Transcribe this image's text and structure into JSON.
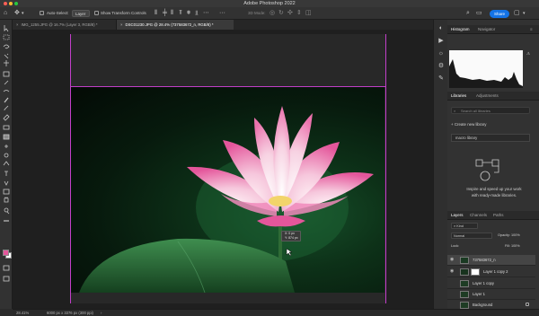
{
  "app": {
    "title": "Adobe Photoshop 2022"
  },
  "options_bar": {
    "auto_select_label": "Auto-Select:",
    "auto_select_value": "Layer",
    "show_transform_label": "Show Transform Controls",
    "mode_3d_label": "3D Mode:",
    "share_label": "Share"
  },
  "doc_tabs": [
    {
      "label": "IMG_1255.JPG @ 16.7% (Layer 3, RGB/8) *"
    },
    {
      "label": "DSC01230.JPG @ 28.4% (737583672_n, RGB/8) *"
    }
  ],
  "tooltip": {
    "x": "X: 0 px",
    "y": "Y: 874 px"
  },
  "status_bar": {
    "zoom": "28.41%",
    "doc_size": "6000 px x 3376 px (300 ppi)"
  },
  "panels": {
    "histogram_tabs": [
      "Histogram",
      "Navigator"
    ],
    "libraries_tabs": [
      "Libraries",
      "Adjustments"
    ],
    "search_placeholder": "Search all libraries",
    "create_library": "Create new library",
    "library_select": "macro library",
    "libraries_message_1": "Inspire and speed up your work",
    "libraries_message_2": "with ready-made libraries.",
    "layers_tabs": [
      "Layers",
      "Channels",
      "Paths"
    ],
    "kind_label": "Kind",
    "blend_mode": "Normal",
    "opacity": "Opacity: 100%",
    "lock_label": "Lock:",
    "fill": "Fill: 100%",
    "layers": [
      {
        "name": "737583672_n"
      },
      {
        "name": "Layer 1 copy 2"
      },
      {
        "name": "Layer 1 copy"
      },
      {
        "name": "Layer 1"
      },
      {
        "name": "Background"
      }
    ]
  },
  "colors": {
    "accent": "#1473e6",
    "guide": "#c23fc9",
    "petal": "#e4569b"
  }
}
